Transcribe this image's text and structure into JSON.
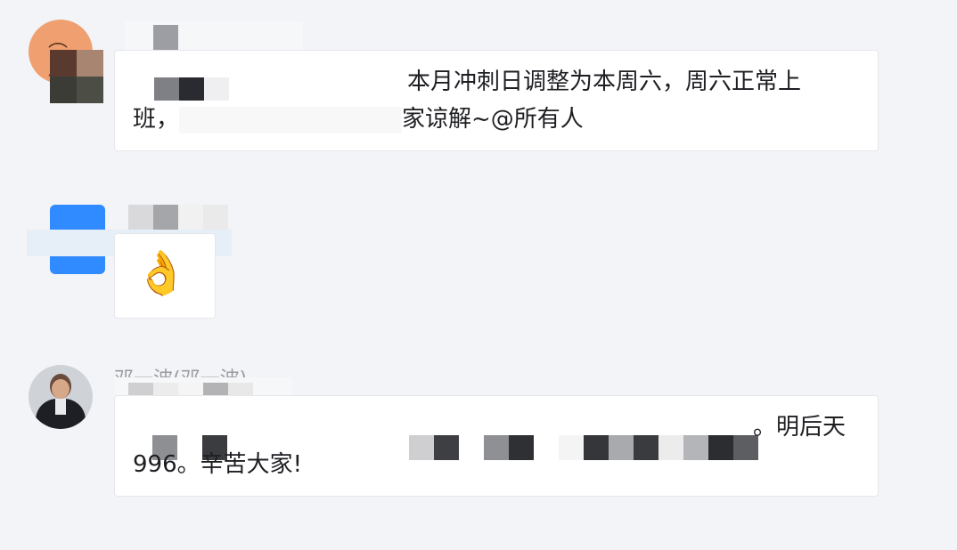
{
  "messages": [
    {
      "line1": "本月冲刺日调整为本周六，周六正常上",
      "line2": "班，"
    },
    {
      "emoji": "👌"
    },
    {
      "sender": "邓一波(邓一波)",
      "line1": "。明后天",
      "line2": "996。辛苦大家!"
    }
  ],
  "line1_tail": "家谅解~@所有人",
  "avatar_icons": [
    "user-avatar-icon",
    "app-avatar-icon",
    "person-photo-avatar-icon"
  ]
}
